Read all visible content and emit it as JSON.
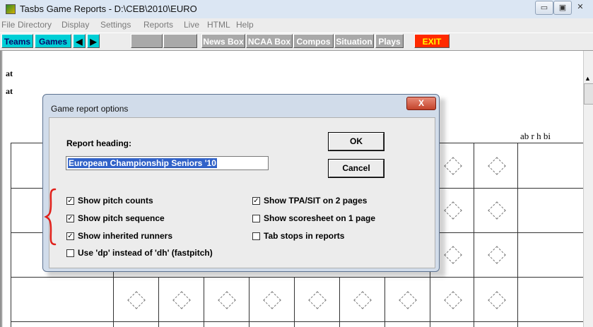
{
  "window": {
    "title": "Tasbs Game Reports - D:\\CEB\\2010\\EURO",
    "minimize": "▭",
    "maximize": "▣",
    "close": "✕"
  },
  "menu": [
    "File",
    "Directory",
    "Display",
    "Settings",
    "Reports",
    "Live",
    "HTML",
    "Help"
  ],
  "toolbar": {
    "teams": "Teams",
    "games": "Games",
    "prev": "◀",
    "next": "▶",
    "news_box": "News Box",
    "ncaa_box": "NCAA Box",
    "compos": "Compos",
    "situation": "Situation",
    "plays": "Plays",
    "exit": "EXIT"
  },
  "report": {
    "row_labels": [
      "at",
      "at"
    ],
    "stats_header": "ab  r  h bi"
  },
  "dialog": {
    "title": "Game report options",
    "close": "X",
    "heading_label": "Report heading:",
    "heading_value": "European Championship Seniors '10",
    "ok": "OK",
    "cancel": "Cancel",
    "options_left": [
      {
        "label": "Show pitch counts",
        "checked": true
      },
      {
        "label": "Show pitch sequence",
        "checked": true
      },
      {
        "label": "Show inherited runners",
        "checked": true
      },
      {
        "label": "Use 'dp' instead of 'dh' (fastpitch)",
        "checked": false
      }
    ],
    "options_right": [
      {
        "label": "Show TPA/SIT on 2 pages",
        "checked": true
      },
      {
        "label": "Show scoresheet on 1 page",
        "checked": false
      },
      {
        "label": "Tab stops in reports",
        "checked": false
      }
    ],
    "check_mark": "✓",
    "annotation_color": "#e0201a"
  }
}
